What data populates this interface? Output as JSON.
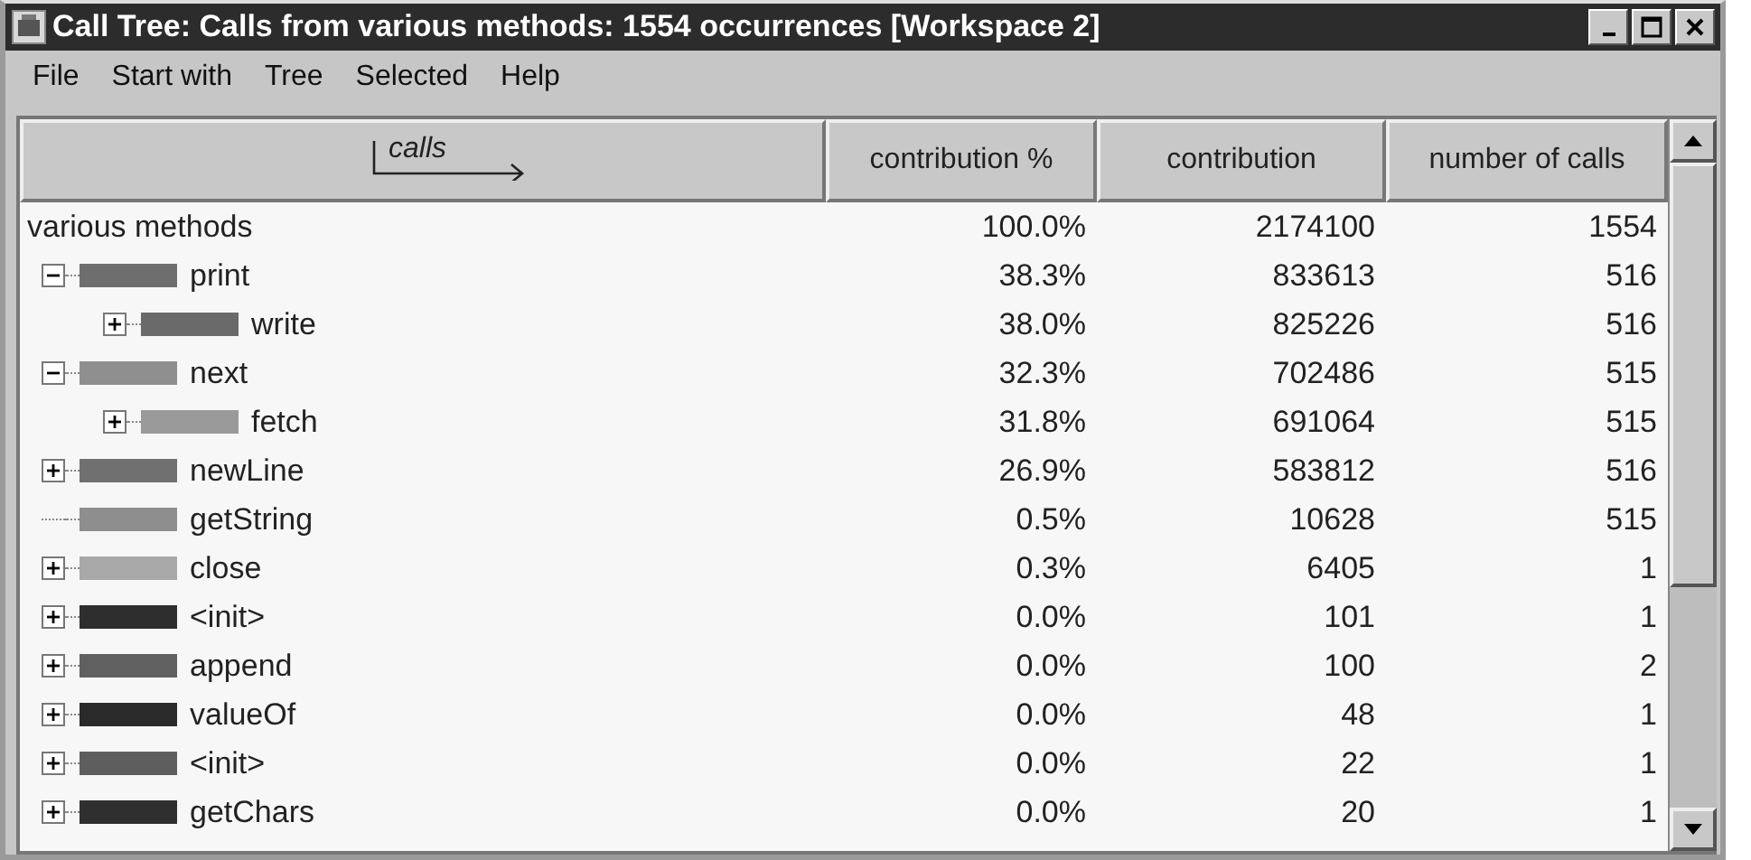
{
  "window": {
    "title": "Call Tree: Calls from various methods: 1554 occurrences [Workspace 2]"
  },
  "menu": [
    "File",
    "Start with",
    "Tree",
    "Selected",
    "Help"
  ],
  "table": {
    "columns": [
      "calls",
      "contribution %",
      "contribution",
      "number of calls"
    ],
    "root": {
      "name": "various methods",
      "percent": "100.0%",
      "contribution": "2174100",
      "calls": "1554"
    },
    "rows": [
      {
        "kind": "node",
        "expanded": true,
        "color": "#6e6e6e",
        "name": "print",
        "percent": "38.3%",
        "contribution": "833613",
        "calls": "516",
        "children": [
          {
            "kind": "node",
            "expanded": false,
            "color": "#6a6a6a",
            "name": "write",
            "percent": "38.0%",
            "contribution": "825226",
            "calls": "516"
          }
        ]
      },
      {
        "kind": "node",
        "expanded": true,
        "color": "#8f8f8f",
        "name": "next",
        "percent": "32.3%",
        "contribution": "702486",
        "calls": "515",
        "children": [
          {
            "kind": "node",
            "expanded": false,
            "color": "#9a9a9a",
            "name": "fetch",
            "percent": "31.8%",
            "contribution": "691064",
            "calls": "515"
          }
        ]
      },
      {
        "kind": "node",
        "expanded": false,
        "color": "#707070",
        "name": "newLine",
        "percent": "26.9%",
        "contribution": "583812",
        "calls": "516"
      },
      {
        "kind": "leaf",
        "color": "#8e8e8e",
        "name": "getString",
        "percent": "0.5%",
        "contribution": "10628",
        "calls": "515"
      },
      {
        "kind": "node",
        "expanded": false,
        "color": "#a8a8a8",
        "name": "close",
        "percent": "0.3%",
        "contribution": "6405",
        "calls": "1"
      },
      {
        "kind": "node",
        "expanded": false,
        "color": "#2e2e2e",
        "name": "<init>",
        "percent": "0.0%",
        "contribution": "101",
        "calls": "1"
      },
      {
        "kind": "node",
        "expanded": false,
        "color": "#606060",
        "name": "append",
        "percent": "0.0%",
        "contribution": "100",
        "calls": "2"
      },
      {
        "kind": "node",
        "expanded": false,
        "color": "#2a2a2a",
        "name": "valueOf",
        "percent": "0.0%",
        "contribution": "48",
        "calls": "1"
      },
      {
        "kind": "node",
        "expanded": false,
        "color": "#5e5e5e",
        "name": "<init>",
        "percent": "0.0%",
        "contribution": "22",
        "calls": "1"
      },
      {
        "kind": "node",
        "expanded": false,
        "color": "#2f2f2f",
        "name": "getChars",
        "percent": "0.0%",
        "contribution": "20",
        "calls": "1"
      }
    ]
  }
}
